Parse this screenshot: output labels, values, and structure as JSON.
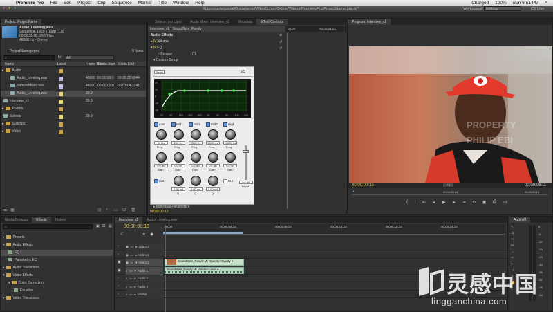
{
  "menubar": {
    "apple": "",
    "app_name": "Premiere Pro",
    "items": [
      "File",
      "Edit",
      "Project",
      "Clip",
      "Sequence",
      "Marker",
      "Title",
      "Window",
      "Help"
    ],
    "status": "iCharged",
    "clock": "Sun 6:51 PM",
    "wifi": "100%"
  },
  "titlebar": {
    "path": "/Users/sammjones/Documents/VideoSchoolOnline/Videos/PremierePro/ProjectName.prproj *",
    "workspace_label": "Workspace:",
    "workspace_value": "Editing",
    "cs_live": "CS Live"
  },
  "project": {
    "tab": "Project: ProjectName",
    "clip_name": "Audio_Leveling.wav",
    "clip_line1": "Sequence, 1920 x 1080 (1.0)",
    "clip_line2": "00:00:35:03, 29.97 fps",
    "clip_line3": "48000 Hz - Stereo",
    "project_file": "ProjectName.prproj",
    "item_count": "9 Items",
    "in_label": "In:",
    "in_value": "All",
    "columns": [
      "Name",
      "Label",
      "Frame Rate",
      "Media Start",
      "Media End"
    ],
    "rows": [
      {
        "name": "Audio",
        "label": "",
        "fr": "",
        "start": "",
        "end": "",
        "indent": 0,
        "color": "#c9a24a",
        "type": "folder"
      },
      {
        "name": "Audio_Leveling.wav",
        "label": "",
        "fr": "48000",
        "start": "00:00:00:0",
        "end": "00:00:35:0044",
        "indent": 1,
        "color": "#c9c0e6",
        "type": "audio"
      },
      {
        "name": "SampleMusic.wav",
        "label": "",
        "fr": "48000",
        "start": "00:00:00:0",
        "end": "00:03:04:3241",
        "indent": 1,
        "color": "#c9c0e6",
        "type": "audio"
      },
      {
        "name": "Audio_Leveling.wav",
        "label": "",
        "fr": "29.9",
        "start": "",
        "end": "",
        "indent": 1,
        "color": "#e6d875",
        "type": "seq"
      },
      {
        "name": "Interview_v1",
        "label": "",
        "fr": "23.9",
        "start": "",
        "end": "",
        "indent": 0,
        "color": "#e6d875",
        "type": "seq"
      },
      {
        "name": "Photos",
        "label": "",
        "fr": "",
        "start": "",
        "end": "",
        "indent": 0,
        "color": "#c9a24a",
        "type": "folder"
      },
      {
        "name": "Selects",
        "label": "",
        "fr": "23.9",
        "start": "",
        "end": "",
        "indent": 0,
        "color": "#e6d875",
        "type": "seq"
      },
      {
        "name": "Subclips",
        "label": "",
        "fr": "",
        "start": "",
        "end": "",
        "indent": 0,
        "color": "#c9a24a",
        "type": "folder"
      },
      {
        "name": "Video",
        "label": "",
        "fr": "",
        "start": "",
        "end": "",
        "indent": 0,
        "color": "#c9a24a",
        "type": "folder"
      }
    ]
  },
  "effect_controls": {
    "tabs": [
      "Source: (no clips)",
      "Audio Mixer: Interview_v1",
      "Metadata",
      "Effect Controls"
    ],
    "clip_header": "Interview_v1 * SoundByte_Family",
    "group": "Audio Effects",
    "tc_start": "00:00",
    "tc_end": "00:00:04:23",
    "volume": "Volume",
    "eq": "EQ",
    "bypass": "Bypass",
    "custom_setup": "Custom Setup",
    "individual": "Individual Parameters",
    "bottom_tc": "00:00:00:13",
    "eq_window": {
      "reset": "Reset",
      "title": "EQ",
      "freq_ticks": [
        "20",
        "50",
        "100",
        "200",
        "500",
        "1K",
        "2K",
        "5K",
        "10K",
        "20K"
      ],
      "db_ticks": [
        "20",
        "10",
        "0",
        "-10",
        "-20"
      ],
      "bands": [
        {
          "name": "Low",
          "freq": "50 Hz",
          "gain": "0.0 dB",
          "q": ""
        },
        {
          "name": "Mid1",
          "freq": "200 Hz",
          "gain": "0.0 dB",
          "q": "0.00 oct"
        },
        {
          "name": "Mid2",
          "freq": "2000 Hz",
          "gain": "0.0 dB",
          "q": "0.00 oct"
        },
        {
          "name": "Mid3",
          "freq": "6000 Hz",
          "gain": "0.0 dB",
          "q": "0.00 oct"
        },
        {
          "name": "High",
          "freq": "10000 Hz",
          "gain": "0.0 dB",
          "q": ""
        }
      ],
      "freq_label": "Freq.",
      "gain_label": "Gain",
      "q_label": "Q",
      "cut_label": "Cut",
      "output_label": "Output",
      "output_value": "0.0 dB"
    }
  },
  "program": {
    "tab": "Program: Interview_v1",
    "watermark": "PROPERTY\nPHILIP EBI",
    "tc_current": "00:00:00:13",
    "fit": "Fit",
    "tc_duration": "00:00:06:11",
    "ruler_mid": "00:04:59:16",
    "ruler_end": "00:09:59:14"
  },
  "effects": {
    "tabs": [
      "Media Browser",
      "Effects",
      "History"
    ],
    "items": [
      {
        "label": "Presets",
        "type": "folder",
        "indent": 0
      },
      {
        "label": "Audio Effects",
        "type": "folder",
        "indent": 0
      },
      {
        "label": "EQ",
        "type": "fx",
        "indent": 1
      },
      {
        "label": "Parametric EQ",
        "type": "fx",
        "indent": 1
      },
      {
        "label": "Audio Transitions",
        "type": "folder",
        "indent": 0
      },
      {
        "label": "Video Effects",
        "type": "folder",
        "indent": 0
      },
      {
        "label": "Color Correction",
        "type": "folder",
        "indent": 1
      },
      {
        "label": "Equalize",
        "type": "fx",
        "indent": 2
      },
      {
        "label": "Video Transitions",
        "type": "folder",
        "indent": 0
      }
    ]
  },
  "timeline": {
    "tabs": [
      "Interview_v1",
      "Audio_Leveling.wav"
    ],
    "tc": "00:00:00:13",
    "ruler": [
      "00:00",
      "00:00:04:23",
      "00:00:09:23",
      "00:00:14:23",
      "00:00:19:23",
      "00:00:24:23"
    ],
    "tracks": [
      "Video 3",
      "Video 2",
      "Video 1",
      "Audio 1",
      "Audio 2",
      "Audio 3",
      "Master"
    ],
    "video_clip": "SoundByte_Family.M| Opacity:Opacity ▾",
    "audio_clip": "SoundByte_Family.M| Volume:Level ▾"
  },
  "audio_meter": {
    "tab": "Audio M",
    "db": [
      "0",
      "-6",
      "-12",
      "-18",
      "-24",
      "-30",
      "-36",
      "-42",
      "-48",
      "-54"
    ]
  },
  "watermark": {
    "brand": "灵感中国",
    "url": "lingganchina.com"
  }
}
